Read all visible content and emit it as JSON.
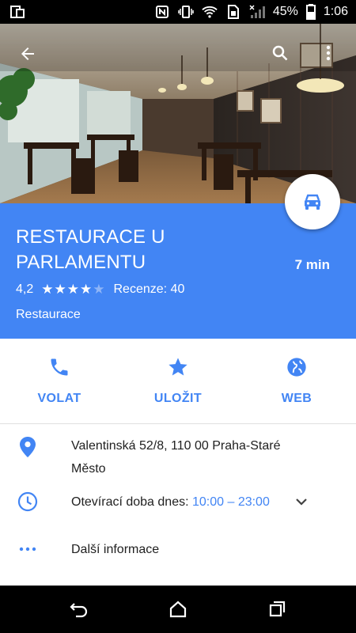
{
  "status_bar": {
    "battery_percent": "45%",
    "time": "1:06"
  },
  "place": {
    "name": "RESTAURACE U PARLAMENTU",
    "rating": "4,2",
    "stars": 4,
    "reviews": "Recenze: 40",
    "category": "Restaurace",
    "travel_time": "7 min"
  },
  "actions": [
    {
      "label": "VOLAT",
      "icon": "phone-icon"
    },
    {
      "label": "ULOŽIT",
      "icon": "star-icon"
    },
    {
      "label": "WEB",
      "icon": "globe-icon"
    }
  ],
  "info": {
    "address_line1": "Valentinská 52/8, 110 00 Praha-Staré",
    "address_line2": "Město",
    "hours_label": "Otevírací doba dnes: ",
    "hours_value": "10:00 – 23:00",
    "more_info": "Další informace"
  },
  "colors": {
    "accent": "#4285f4",
    "text": "#212121",
    "icon": "#4285f4"
  }
}
